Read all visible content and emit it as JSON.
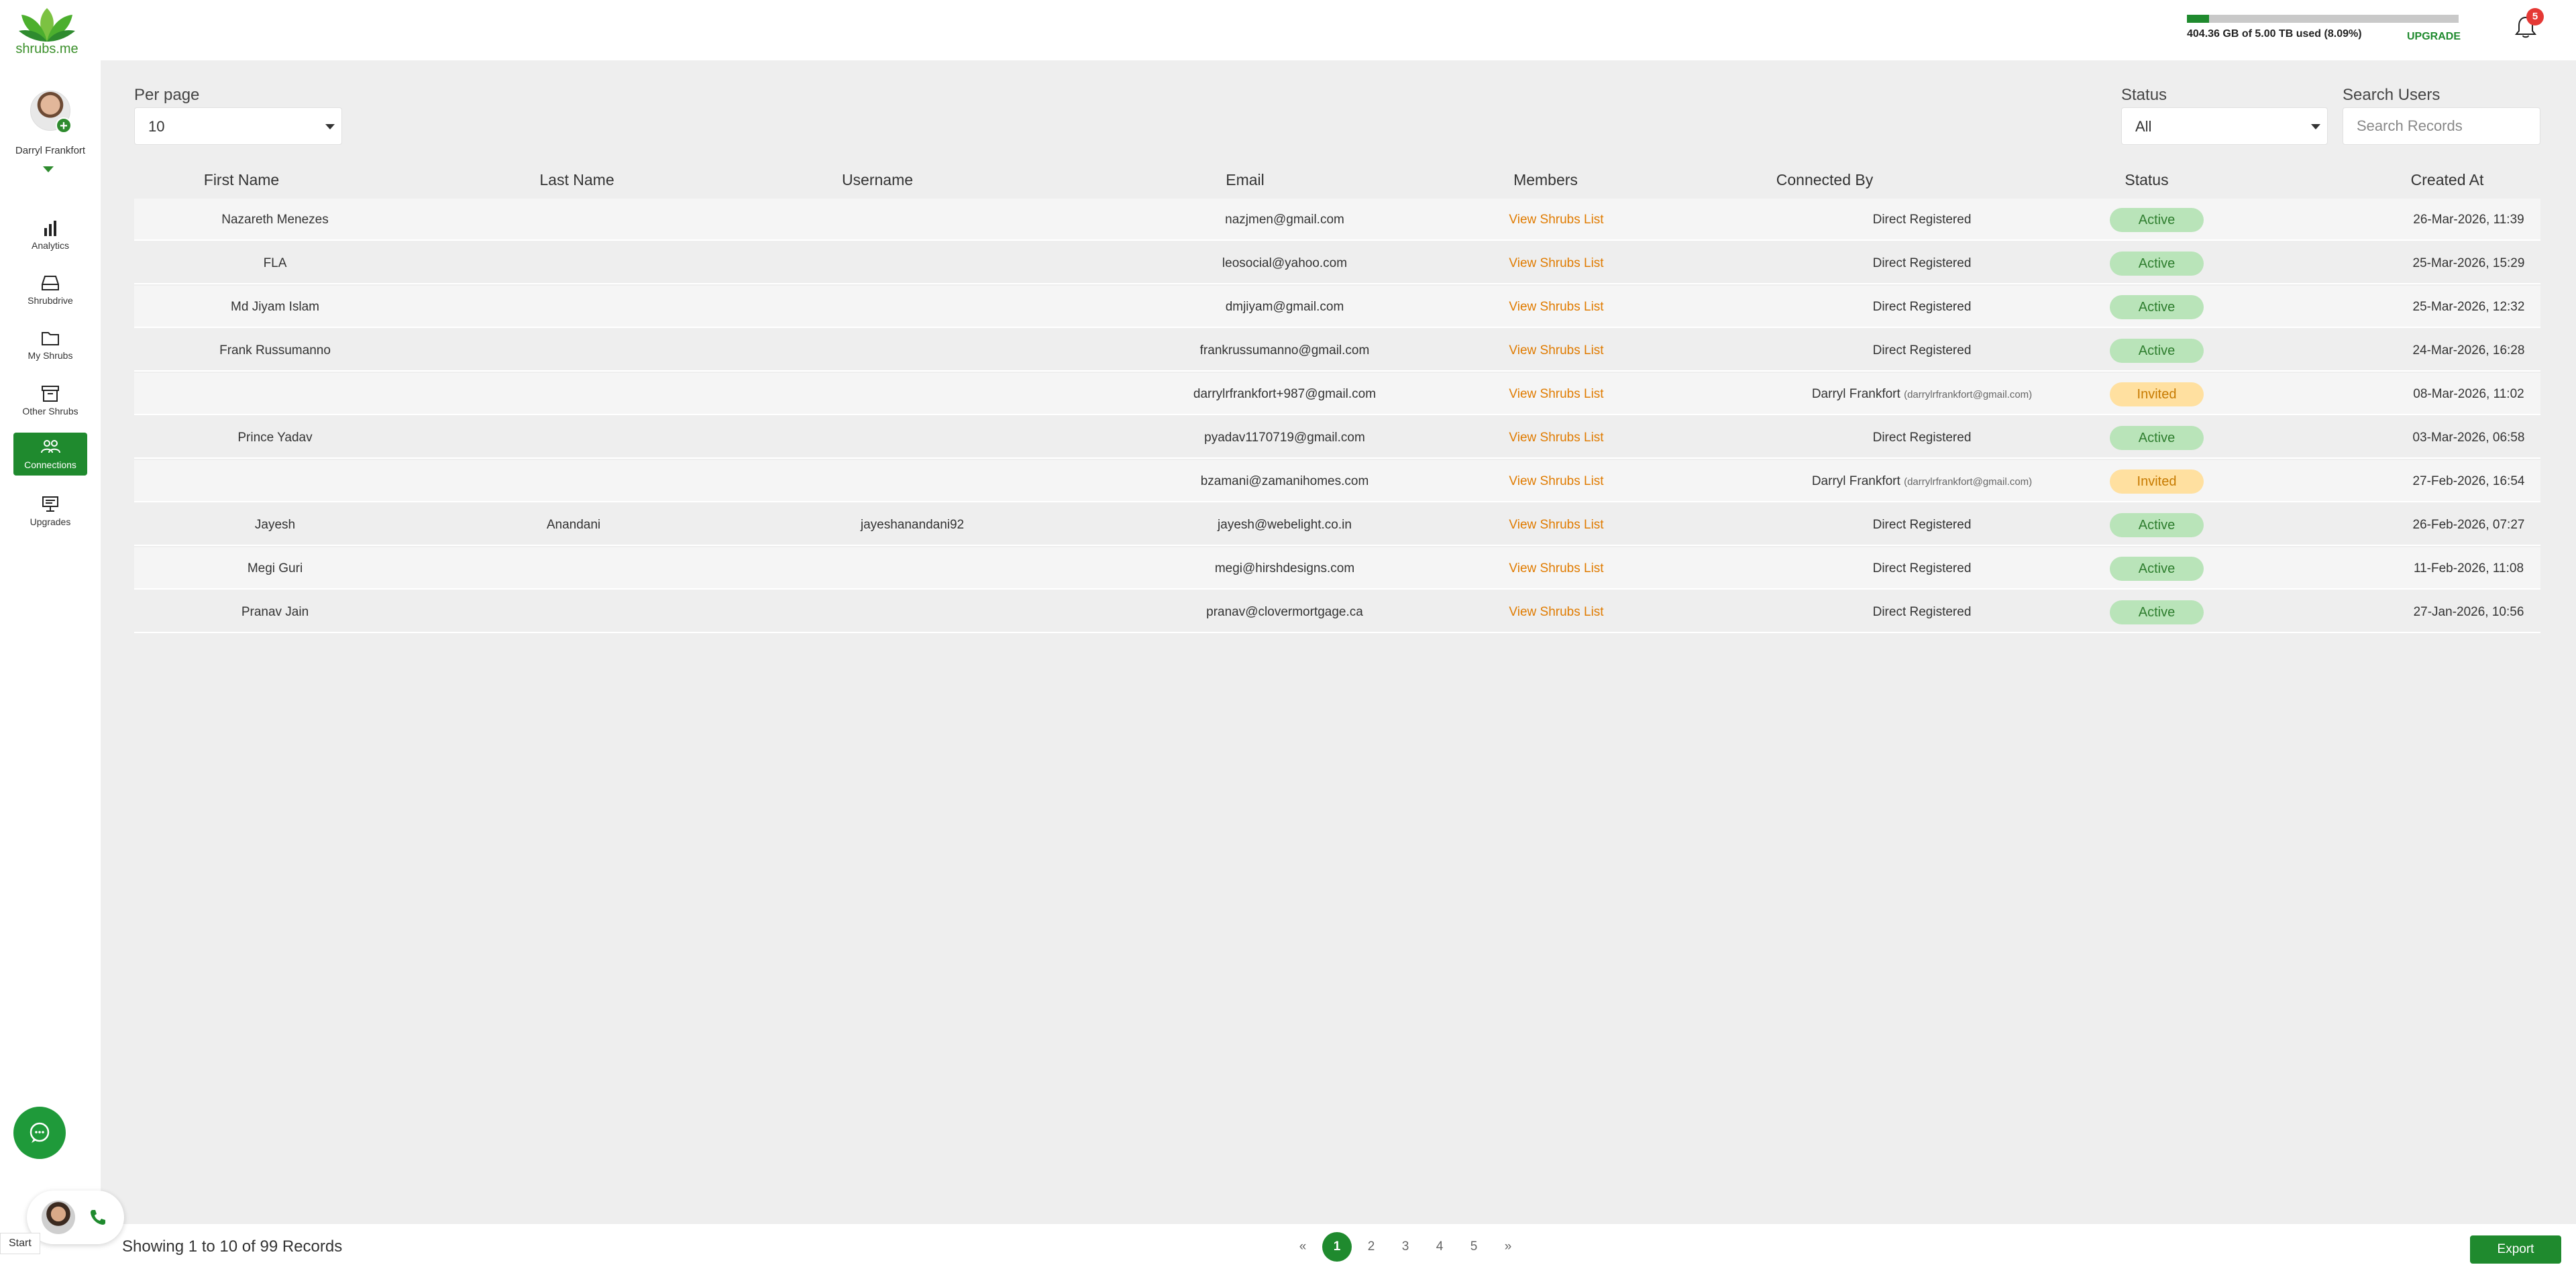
{
  "brand": {
    "logo_text": "shrubs.me"
  },
  "user": {
    "name": "Darryl Frankfort"
  },
  "sidebar": {
    "items": [
      {
        "label": "Analytics",
        "icon": "bar-chart-icon",
        "active": false
      },
      {
        "label": "Shrubdrive",
        "icon": "drive-icon",
        "active": false
      },
      {
        "label": "My Shrubs",
        "icon": "folder-icon",
        "active": false
      },
      {
        "label": "Other Shrubs",
        "icon": "archive-icon",
        "active": false
      },
      {
        "label": "Connections",
        "icon": "users-icon",
        "active": true
      },
      {
        "label": "Upgrades",
        "icon": "upgrade-icon",
        "active": false
      }
    ]
  },
  "topbar": {
    "storage_text": "404.36 GB of 5.00 TB used (8.09%)",
    "storage_fraction": 0.0809,
    "upgrade_label": "UPGRADE",
    "notification_count": "5"
  },
  "filters": {
    "per_page_label": "Per page",
    "per_page_value": "10",
    "status_label": "Status",
    "status_value": "All",
    "search_label": "Search Users",
    "search_placeholder": "Search Records"
  },
  "table": {
    "columns": [
      "First Name",
      "Last Name",
      "Username",
      "Email",
      "Members",
      "Connected By",
      "Status",
      "Created At"
    ],
    "rows": [
      {
        "first": "Nazareth Menezes",
        "last": "",
        "username": "",
        "email": "nazjmen@gmail.com",
        "members": "View Shrubs List",
        "connected_by": "Direct Registered",
        "connected_sub": "",
        "status": "Active",
        "created": "26-Mar-2026, 11:39"
      },
      {
        "first": "FLA",
        "last": "",
        "username": "",
        "email": "leosocial@yahoo.com",
        "members": "View Shrubs List",
        "connected_by": "Direct Registered",
        "connected_sub": "",
        "status": "Active",
        "created": "25-Mar-2026, 15:29"
      },
      {
        "first": "Md Jiyam Islam",
        "last": "",
        "username": "",
        "email": "dmjiyam@gmail.com",
        "members": "View Shrubs List",
        "connected_by": "Direct Registered",
        "connected_sub": "",
        "status": "Active",
        "created": "25-Mar-2026, 12:32"
      },
      {
        "first": "Frank Russumanno",
        "last": "",
        "username": "",
        "email": "frankrussumanno@gmail.com",
        "members": "View Shrubs List",
        "connected_by": "Direct Registered",
        "connected_sub": "",
        "status": "Active",
        "created": "24-Mar-2026, 16:28"
      },
      {
        "first": "",
        "last": "",
        "username": "",
        "email": "darrylrfrankfort+987@gmail.com",
        "members": "View Shrubs List",
        "connected_by": "Darryl Frankfort",
        "connected_sub": "(darrylrfrankfort@gmail.com)",
        "status": "Invited",
        "created": "08-Mar-2026, 11:02"
      },
      {
        "first": "Prince Yadav",
        "last": "",
        "username": "",
        "email": "pyadav1170719@gmail.com",
        "members": "View Shrubs List",
        "connected_by": "Direct Registered",
        "connected_sub": "",
        "status": "Active",
        "created": "03-Mar-2026, 06:58"
      },
      {
        "first": "",
        "last": "",
        "username": "",
        "email": "bzamani@zamanihomes.com",
        "members": "View Shrubs List",
        "connected_by": "Darryl Frankfort",
        "connected_sub": "(darrylrfrankfort@gmail.com)",
        "status": "Invited",
        "created": "27-Feb-2026, 16:54"
      },
      {
        "first": "Jayesh",
        "last": "Anandani",
        "username": "jayeshanandani92",
        "email": "jayesh@webelight.co.in",
        "members": "View Shrubs List",
        "connected_by": "Direct Registered",
        "connected_sub": "",
        "status": "Active",
        "created": "26-Feb-2026, 07:27"
      },
      {
        "first": "Megi Guri",
        "last": "",
        "username": "",
        "email": "megi@hirshdesigns.com",
        "members": "View Shrubs List",
        "connected_by": "Direct Registered",
        "connected_sub": "",
        "status": "Active",
        "created": "11-Feb-2026, 11:08"
      },
      {
        "first": "Pranav Jain",
        "last": "",
        "username": "",
        "email": "pranav@clovermortgage.ca",
        "members": "View Shrubs List",
        "connected_by": "Direct Registered",
        "connected_sub": "",
        "status": "Active",
        "created": "27-Jan-2026, 10:56"
      }
    ]
  },
  "footer": {
    "showing_text": "Showing 1 to 10 of 99 Records",
    "pages": [
      "«",
      "1",
      "2",
      "3",
      "4",
      "5",
      "»"
    ],
    "current_page": "1",
    "export_label": "Export"
  },
  "widget": {
    "start_label": "Start"
  },
  "colors": {
    "brand_green": "#1f8a2e",
    "link_orange": "#e07b00",
    "active_bg": "#b9e4b9",
    "invited_bg": "#ffe0a0"
  }
}
